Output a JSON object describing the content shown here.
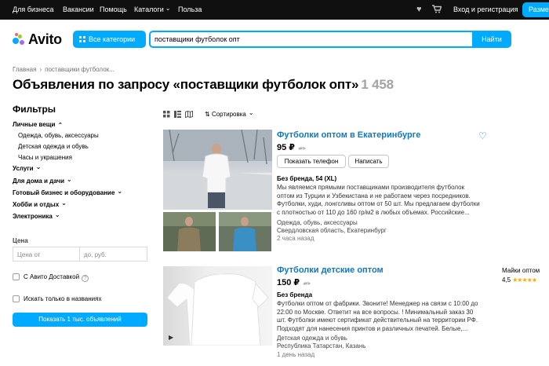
{
  "topbar": {
    "nav": [
      "Для бизнеса",
      "Вакансии",
      "Помощь",
      "Каталоги",
      "Польза"
    ],
    "icons": [
      "heart-icon",
      "cart-icon"
    ],
    "login": "Вход и регистрация",
    "place_ad": "Разместить объявление"
  },
  "header": {
    "logo": "Avito",
    "all_categories": "Все категории",
    "search_value": "поставщики футболок опт",
    "search_button": "Найти"
  },
  "breadcrumb": [
    "Главная",
    "поставщики футболок..."
  ],
  "page": {
    "title": "Объявления по запросу «поставщики футболок опт»",
    "count": "1 458"
  },
  "sidebar": {
    "title": "Фильтры",
    "personal": "Личные вещи",
    "personal_items": [
      "Одежда, обувь, аксессуары",
      "Детская одежда и обувь",
      "Часы и украшения"
    ],
    "groups": [
      "Услуги",
      "Для дома и дачи",
      "Готовый бизнес и оборудование",
      "Хобби и отдых",
      "Электроника"
    ],
    "price_label": "Цена",
    "price_from": "Цена от",
    "price_to": "до, руб.",
    "avito_delivery": "С Авито Доставкой",
    "titles_only": "Искать только в названиях",
    "show_button": "Показать 1 тыс. объявлений"
  },
  "sort": {
    "label": "Сортировка",
    "view_icons": [
      "grid-view-icon",
      "list-view-icon",
      "map-view-icon"
    ]
  },
  "listings": [
    {
      "title": "Футболки оптом в Екатеринбурге",
      "price": "95 ₽",
      "show_phone": "Показать телефон",
      "write": "Написать",
      "condition": "Без бренда, 54 (XL)",
      "description": "Мы являемся прямыми поставщиками производителя футболок оптом из Турции и Узбекистана и не работаем через посредников. Футболки, худи, лонгсливы оптом от 50 шт. Мы предлагаем футболки с плотностью от 110 до 160 гр/м2 в любых объемах. Российские...",
      "category": "Одежда, обувь, аксессуары",
      "location": "Свердловская область, Екатеринбург",
      "time": "2 часа назад"
    },
    {
      "title": "Футболки детские оптом",
      "price": "150 ₽",
      "condition": "Без бренда",
      "description": "Футболки оптом от фабрики. Звоните! Менеджер на связи с 10:00 до 22:00 по Москве. Ответит на все вопросы. ! Минимальный заказ 30 шт. Футболки имеют сертификат действительный на территории РФ. Подходят для нанесения принтов и различных печатей. Белые,...",
      "category": "Детская одежда и обувь",
      "location": "Республика Татарстан, Казань",
      "time": "1 день назад"
    }
  ],
  "seller": {
    "name": "Майки оптом",
    "rating": "4,5",
    "stars": "★★★★★"
  },
  "colors": {
    "accent": "#00aaff",
    "link": "#0a79c6",
    "topbar": "#101010",
    "star": "#ffaa00"
  }
}
